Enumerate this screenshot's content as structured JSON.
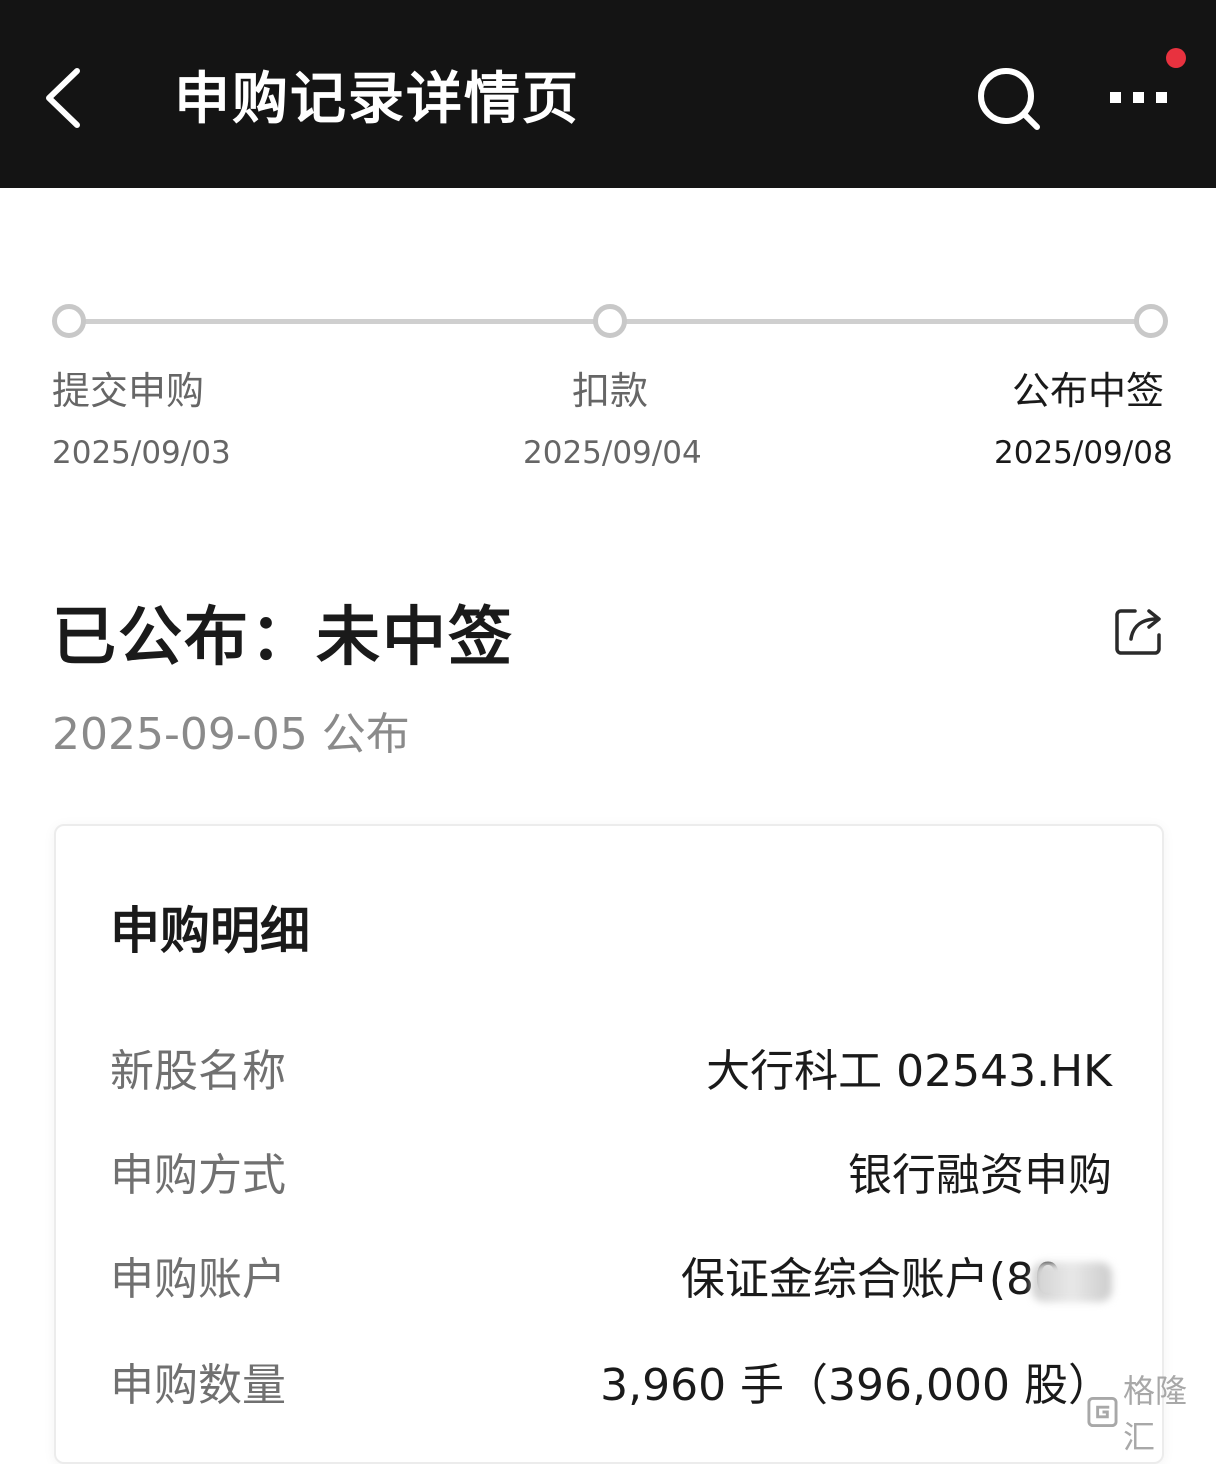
{
  "header": {
    "title": "申购记录详情页",
    "back_icon": "chevron-left-icon",
    "search_icon": "search-icon",
    "more_icon": "more-dots-icon",
    "notification_dot_color": "#e8323f"
  },
  "progress": {
    "steps": [
      {
        "label": "提交申购",
        "date": "2025/09/03",
        "active": false
      },
      {
        "label": "扣款",
        "date": "2025/09/04",
        "active": false
      },
      {
        "label": "公布中签",
        "date": "2025/09/08",
        "active": true
      }
    ]
  },
  "status": {
    "title": "已公布：未中签",
    "date": "2025-09-05 公布",
    "share_icon": "share-icon"
  },
  "detail": {
    "title": "申购明细",
    "rows": [
      {
        "label": "新股名称",
        "value": "大行科工 02543.HK"
      },
      {
        "label": "申购方式",
        "value": "银行融资申购"
      },
      {
        "label": "申购账户",
        "value": "保证金综合账户(80"
      },
      {
        "label": "申购数量",
        "value": "3,960 手（396,000 股）"
      }
    ]
  },
  "watermark": {
    "text": "格隆汇",
    "icon": "gelonghui-logo-icon"
  }
}
